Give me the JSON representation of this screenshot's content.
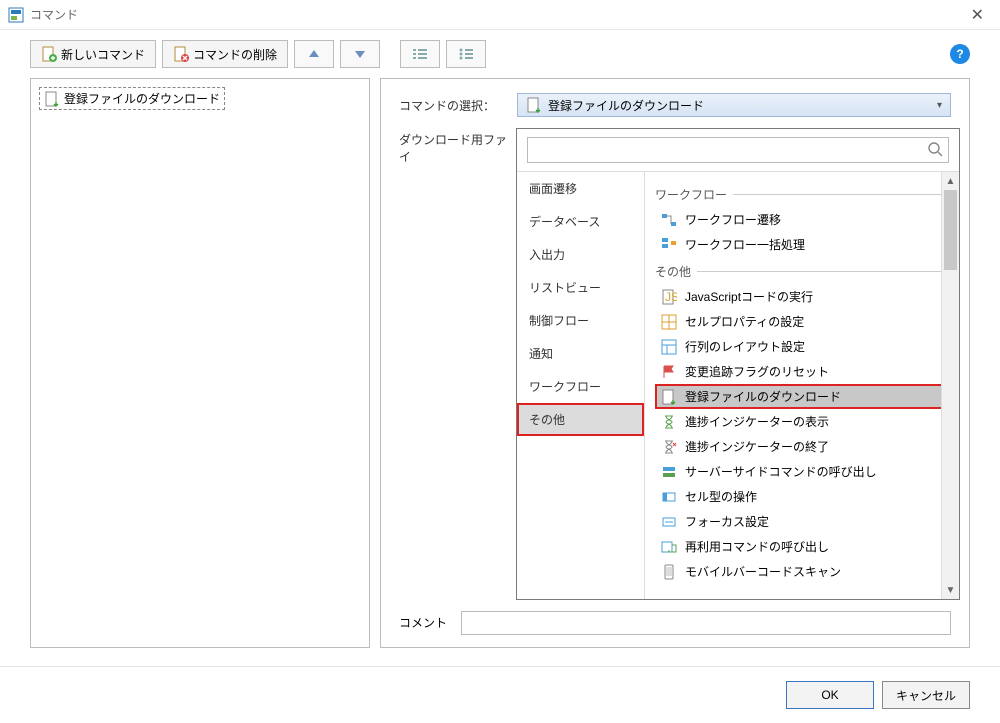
{
  "window": {
    "title": "コマンド"
  },
  "toolbar": {
    "new_cmd": "新しいコマンド",
    "delete_cmd": "コマンドの削除"
  },
  "tree": {
    "item0": "登録ファイルのダウンロード"
  },
  "form": {
    "select_label": "コマンドの選択：",
    "select_value": "登録ファイルのダウンロード",
    "download_label": "ダウンロード用ファイ",
    "comment_label": "コメント"
  },
  "categories": {
    "c0": "画面遷移",
    "c1": "データベース",
    "c2": "入出力",
    "c3": "リストビュー",
    "c4": "制御フロー",
    "c5": "通知",
    "c6": "ワークフロー",
    "c7": "その他"
  },
  "groups": {
    "g0": "ワークフロー",
    "g1": "その他"
  },
  "commands": {
    "wf0": "ワークフロー遷移",
    "wf1": "ワークフロー一括処理",
    "o0": "JavaScriptコードの実行",
    "o1": "セルプロパティの設定",
    "o2": "行列のレイアウト設定",
    "o3": "変更追跡フラグのリセット",
    "o4": "登録ファイルのダウンロード",
    "o5": "進捗インジケーターの表示",
    "o6": "進捗インジケーターの終了",
    "o7": "サーバーサイドコマンドの呼び出し",
    "o8": "セル型の操作",
    "o9": "フォーカス設定",
    "o10": "再利用コマンドの呼び出し",
    "o11": "モバイルバーコードスキャン"
  },
  "buttons": {
    "ok": "OK",
    "cancel": "キャンセル"
  }
}
